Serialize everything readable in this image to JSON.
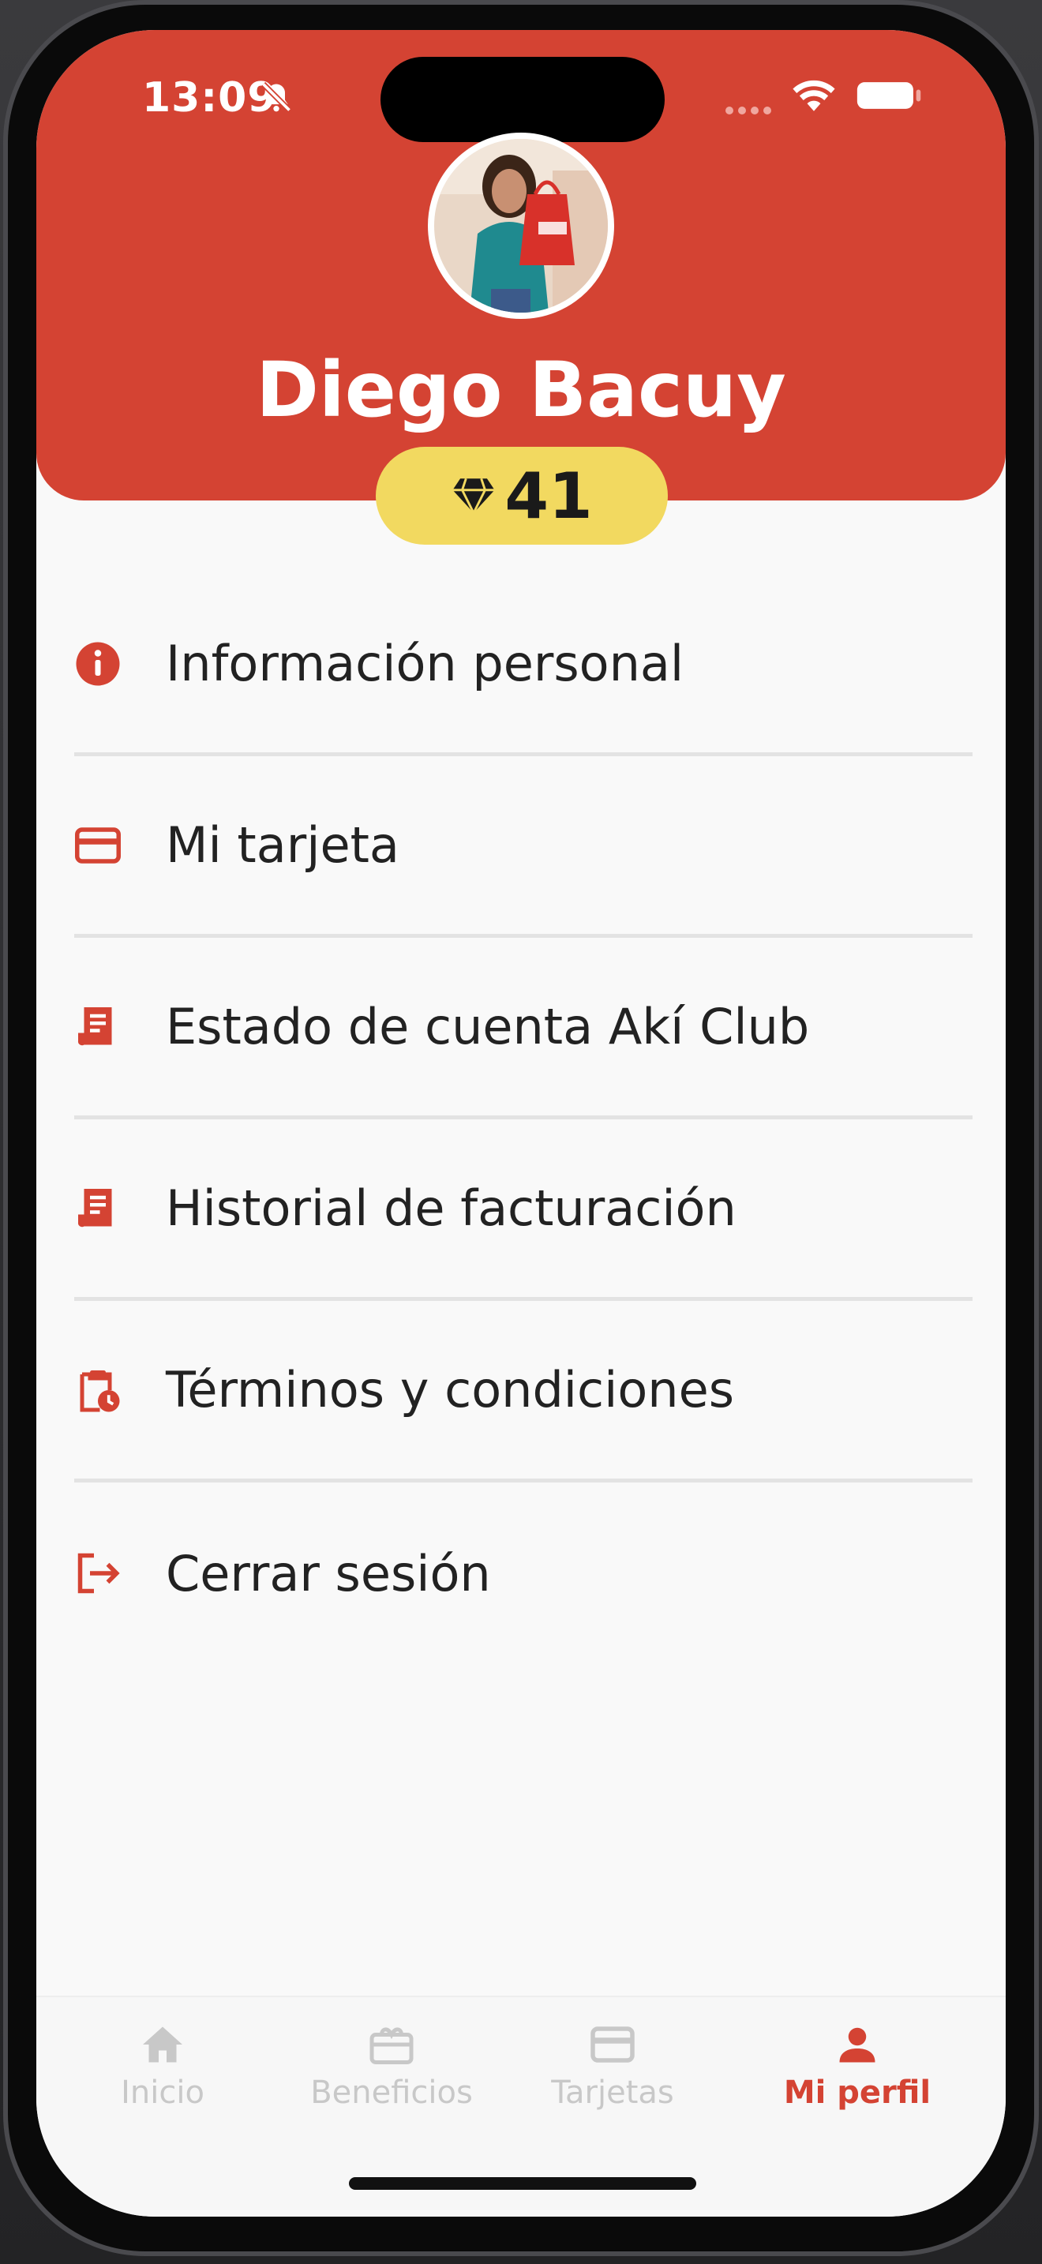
{
  "status_bar": {
    "time": "13:09"
  },
  "profile": {
    "name": "Diego Bacuy",
    "points": "41"
  },
  "menu": {
    "items": [
      {
        "label": "Información personal",
        "icon": "info-icon"
      },
      {
        "label": "Mi tarjeta",
        "icon": "credit-card-icon"
      },
      {
        "label": "Estado de cuenta Akí Club",
        "icon": "receipt-icon"
      },
      {
        "label": "Historial de facturación",
        "icon": "receipt-icon"
      },
      {
        "label": "Términos y condiciones",
        "icon": "clipboard-clock-icon"
      },
      {
        "label": "Cerrar sesión",
        "icon": "logout-icon"
      }
    ]
  },
  "tabbar": {
    "tabs": [
      {
        "label": "Inicio",
        "icon": "home-icon"
      },
      {
        "label": "Beneficios",
        "icon": "gift-icon"
      },
      {
        "label": "Tarjetas",
        "icon": "card-icon"
      },
      {
        "label": "Mi perfil",
        "icon": "person-icon",
        "active": true
      }
    ]
  },
  "colors": {
    "brand": "#d44333",
    "badge": "#f2d960",
    "inactive": "#c8c8c8"
  }
}
